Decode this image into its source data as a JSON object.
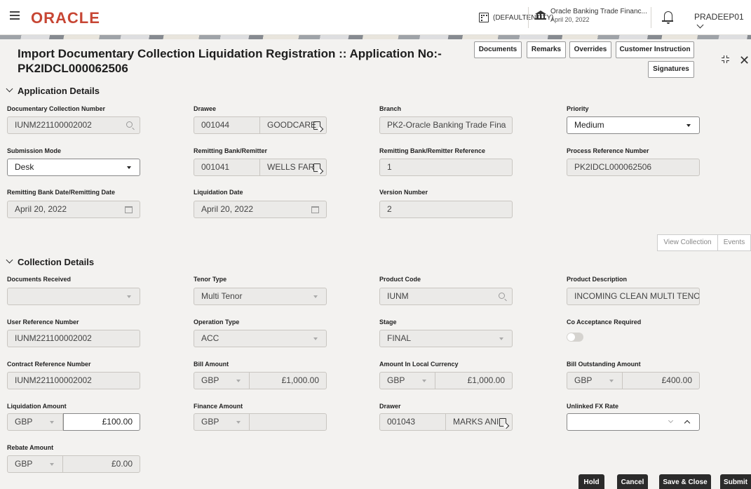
{
  "header": {
    "logo": "ORACLE",
    "entity": "(DEFAULTENTITY)",
    "bank_name": "Oracle Banking Trade Financ...",
    "bank_date": "April 20, 2022",
    "user": "PRADEEP01"
  },
  "title": {
    "line1": "Import Documentary Collection Liquidation Registration :: Application No:-",
    "line2": "PK2IDCL000062506"
  },
  "toolbar": {
    "documents": "Documents",
    "remarks": "Remarks",
    "overrides": "Overrides",
    "customer_instruction": "Customer Instruction",
    "signatures": "Signatures"
  },
  "application_details": {
    "heading": "Application Details",
    "doc_collection_number": {
      "label": "Documentary Collection Number",
      "value": "IUNM221100002002"
    },
    "drawee": {
      "label": "Drawee",
      "id": "001044",
      "name": "GOODCARE"
    },
    "branch": {
      "label": "Branch",
      "value": "PK2-Oracle Banking Trade Fina"
    },
    "priority": {
      "label": "Priority",
      "value": "Medium"
    },
    "submission_mode": {
      "label": "Submission Mode",
      "value": "Desk"
    },
    "remitting_bank": {
      "label": "Remitting Bank/Remitter",
      "id": "001041",
      "name": "WELLS FAR"
    },
    "remitting_reference": {
      "label": "Remitting Bank/Remitter Reference",
      "value": "1"
    },
    "process_reference": {
      "label": "Process Reference Number",
      "value": "PK2IDCL000062506"
    },
    "remitting_date": {
      "label": "Remitting Bank Date/Remitting Date",
      "value": "April 20, 2022"
    },
    "liquidation_date": {
      "label": "Liquidation Date",
      "value": "April 20, 2022"
    },
    "version_number": {
      "label": "Version Number",
      "value": "2"
    }
  },
  "side_buttons": {
    "view_collection": "View Collection",
    "events": "Events"
  },
  "collection_details": {
    "heading": "Collection Details",
    "documents_received": {
      "label": "Documents Received",
      "value": ""
    },
    "tenor_type": {
      "label": "Tenor Type",
      "value": "Multi Tenor"
    },
    "product_code": {
      "label": "Product Code",
      "value": "IUNM"
    },
    "product_description": {
      "label": "Product Description",
      "value": "INCOMING CLEAN MULTI TENOR B"
    },
    "user_reference": {
      "label": "User Reference Number",
      "value": "IUNM221100002002"
    },
    "operation_type": {
      "label": "Operation Type",
      "value": "ACC"
    },
    "stage": {
      "label": "Stage",
      "value": "FINAL"
    },
    "co_acceptance": {
      "label": "Co Acceptance Required"
    },
    "contract_reference": {
      "label": "Contract Reference Number",
      "value": "IUNM221100002002"
    },
    "bill_amount": {
      "label": "Bill Amount",
      "currency": "GBP",
      "value": "£1,000.00"
    },
    "local_amount": {
      "label": "Amount In Local Currency",
      "currency": "GBP",
      "value": "£1,000.00"
    },
    "outstanding_amount": {
      "label": "Bill Outstanding Amount",
      "currency": "GBP",
      "value": "£400.00"
    },
    "liquidation_amount": {
      "label": "Liquidation Amount",
      "currency": "GBP",
      "value": "£100.00"
    },
    "finance_amount": {
      "label": "Finance Amount",
      "currency": "GBP",
      "value": ""
    },
    "drawer": {
      "label": "Drawer",
      "id": "001043",
      "name": "MARKS ANI"
    },
    "unlinked_fx": {
      "label": "Unlinked FX Rate",
      "value": ""
    },
    "rebate_amount": {
      "label": "Rebate Amount",
      "currency": "GBP",
      "value": "£0.00"
    }
  },
  "actions": {
    "hold": "Hold",
    "cancel": "Cancel",
    "save_close": "Save & Close",
    "submit": "Submit"
  }
}
